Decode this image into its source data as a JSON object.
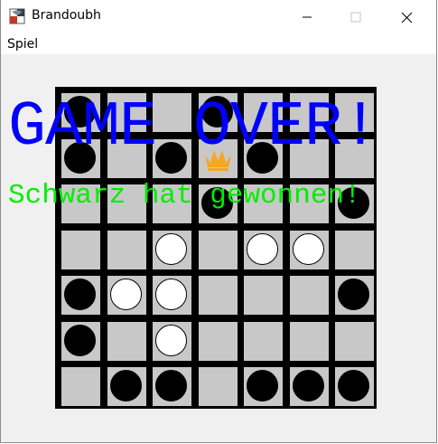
{
  "window": {
    "title": "Brandoubh",
    "icon": "app-board-icon",
    "controls": [
      "minimize-icon",
      "maximize-icon",
      "close-icon"
    ]
  },
  "menubar": {
    "items": [
      {
        "label": "Spiel"
      }
    ]
  },
  "board": {
    "size": 7,
    "colors": {
      "light_square": "#c8c8c8",
      "grid": "#000000",
      "king": "#f5a623"
    },
    "rows": [
      [
        "B",
        "",
        "",
        "B",
        "",
        "",
        ""
      ],
      [
        "B",
        "",
        "B",
        "K",
        "B",
        "",
        ""
      ],
      [
        "",
        "",
        "",
        "B",
        "",
        "",
        "B"
      ],
      [
        "",
        "",
        "W",
        "",
        "W",
        "W",
        ""
      ],
      [
        "B",
        "W",
        "W",
        "",
        "",
        "",
        "B"
      ],
      [
        "B",
        "",
        "W",
        "",
        "",
        "",
        ""
      ],
      [
        "",
        "B",
        "B",
        "",
        "B",
        "B",
        "B"
      ]
    ]
  },
  "overlay": {
    "title": "GAME OVER!",
    "subtitle": "Schwarz hat gewonnen!",
    "title_color": "#0000ff",
    "subtitle_color": "#00ee00"
  }
}
